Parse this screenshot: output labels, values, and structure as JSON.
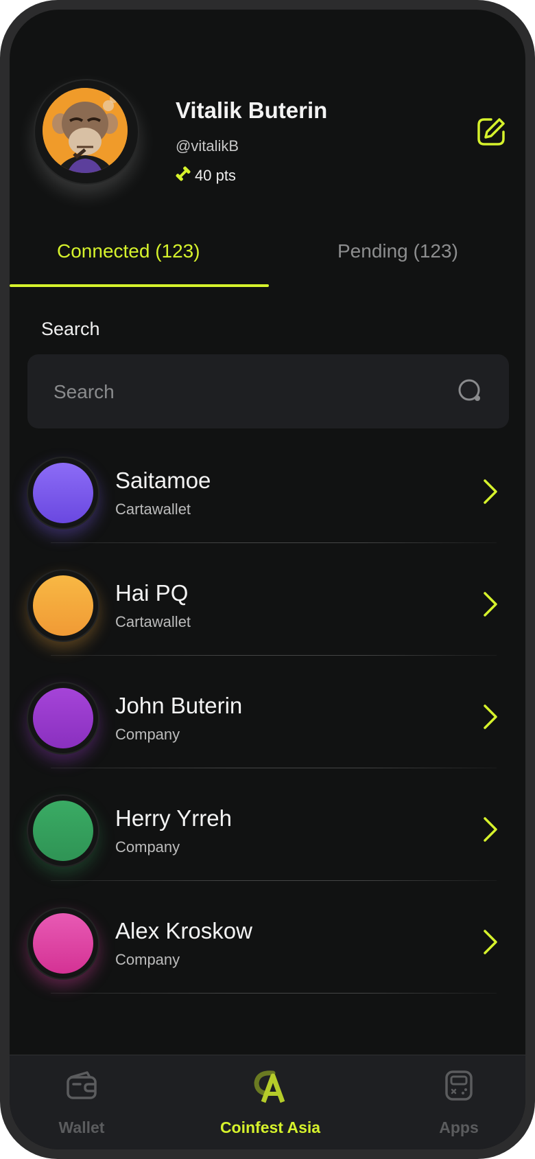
{
  "profile": {
    "name": "Vitalik Buterin",
    "handle": "@vitalikB",
    "points": "40 pts",
    "avatar_icon": "ape-avatar",
    "edit_icon": "edit-icon"
  },
  "tabs": [
    {
      "label": "Connected (123)",
      "active": true
    },
    {
      "label": "Pending (123)",
      "active": false
    }
  ],
  "search": {
    "label": "Search",
    "placeholder": "Search"
  },
  "contacts": [
    {
      "name": "Saitamoe",
      "company": "Cartawallet",
      "color": "#7b5cf0"
    },
    {
      "name": "Hai PQ",
      "company": "Cartawallet",
      "color": "#f5a93b"
    },
    {
      "name": "John Buterin",
      "company": "Company",
      "color": "#9a3ccc"
    },
    {
      "name": "Herry Yrreh",
      "company": "Company",
      "color": "#35a35e"
    },
    {
      "name": "Alex Kroskow",
      "company": "Company",
      "color": "#e040a4"
    }
  ],
  "nav": {
    "wallet": "Wallet",
    "coinfest": "Coinfest Asia",
    "apps": "Apps"
  },
  "colors": {
    "accent": "#d6f22c",
    "background": "#111212",
    "surface": "#1e1f22"
  }
}
